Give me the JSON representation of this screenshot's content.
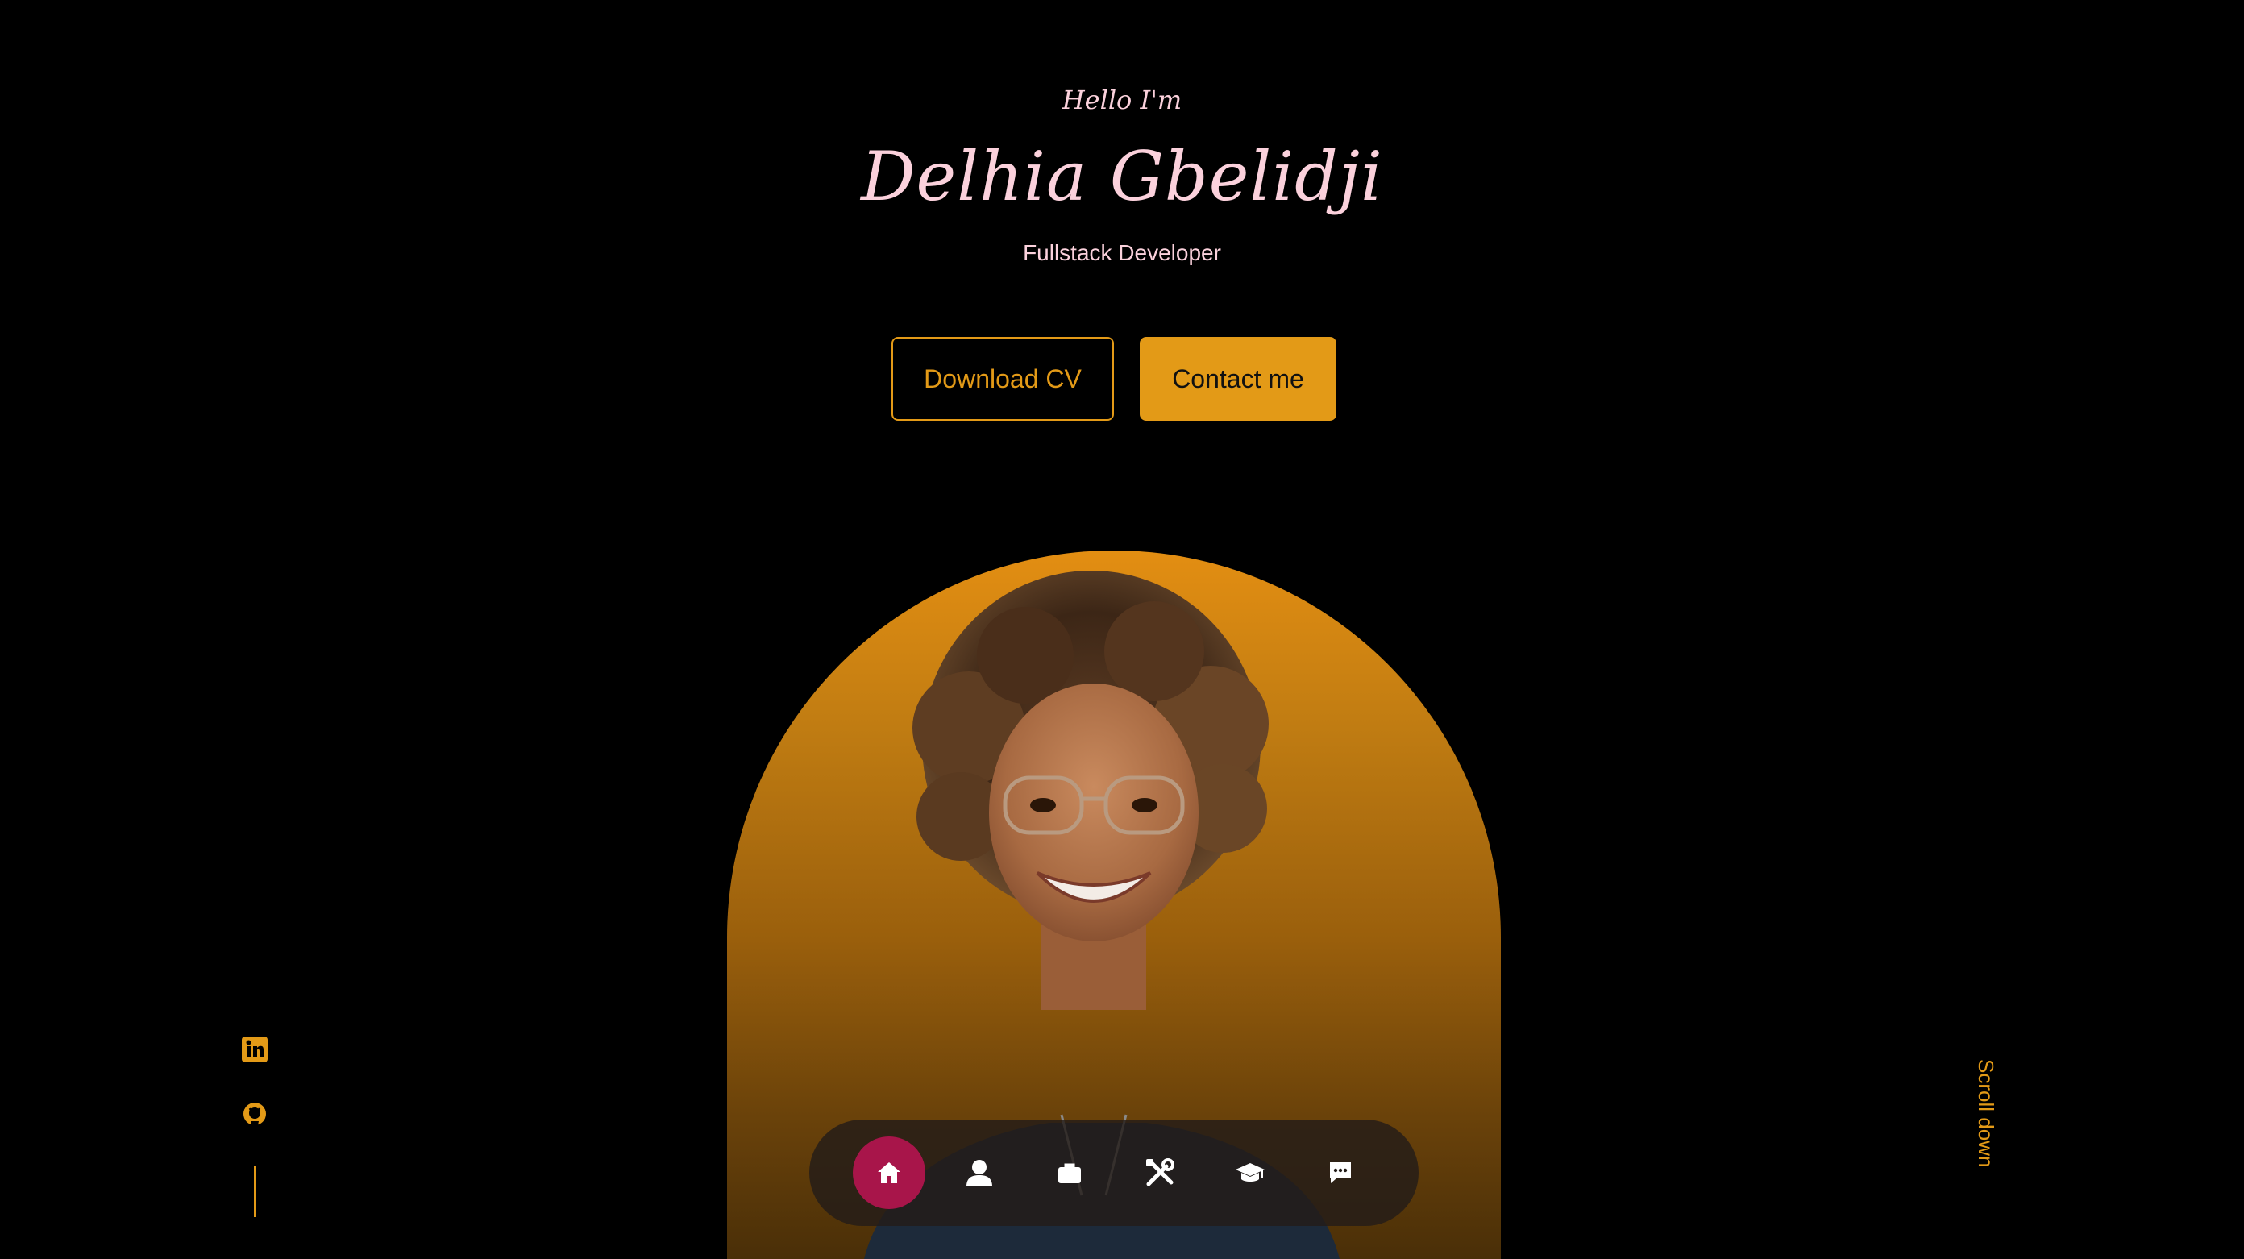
{
  "hero": {
    "greeting": "Hello I'm",
    "name": "Delhia Gbelidji",
    "role": "Fullstack Developer"
  },
  "actions": {
    "download_cv": "Download CV",
    "contact_me": "Contact me"
  },
  "socials": [
    {
      "icon": "linkedin-icon"
    },
    {
      "icon": "github-icon"
    }
  ],
  "scroll": {
    "label": "Scroll down"
  },
  "nav": {
    "items": [
      {
        "icon": "home-icon",
        "active": true
      },
      {
        "icon": "user-icon",
        "active": false
      },
      {
        "icon": "briefcase-icon",
        "active": false
      },
      {
        "icon": "tools-icon",
        "active": false
      },
      {
        "icon": "graduation-cap-icon",
        "active": false
      },
      {
        "icon": "chat-icon",
        "active": false
      }
    ]
  },
  "colors": {
    "background": "#000000",
    "accent": "#e39a17",
    "name_pink": "#fbd1dc",
    "nav_active": "#a8154a",
    "nav_bar": "#231c18"
  }
}
